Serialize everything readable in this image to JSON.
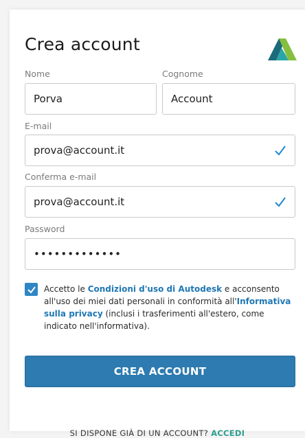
{
  "form": {
    "title": "Crea account",
    "first_name_label": "Nome",
    "first_name_value": "Porva",
    "last_name_label": "Cognome",
    "last_name_value": "Account",
    "email_label": "E-mail",
    "email_value": "prova@account.it",
    "confirm_email_label": "Conferma e-mail",
    "confirm_email_value": "prova@account.it",
    "password_label": "Password",
    "password_value": "•••••••••••••"
  },
  "consent": {
    "checked": true,
    "text_1": "Accetto le ",
    "terms_link": "Condizioni d'uso di Autodesk",
    "text_2": " e acconsento all'uso dei miei dati personali in conformità all'",
    "privacy_link": "Informativa sulla privacy",
    "text_3": " (inclusi i trasferimenti all'estero, come indicato nell'informativa)."
  },
  "submit_label": "CREA ACCOUNT",
  "footer": {
    "prompt": "SI DISPONE GIÀ DI UN ACCOUNT? ",
    "signin_link": "ACCEDI"
  },
  "colors": {
    "accent": "#2d7bb0",
    "link": "#1f77b4",
    "check": "#1f87d0",
    "signin": "#2e9e8f"
  },
  "icons": {
    "logo": "autodesk-logo",
    "valid": "checkmark-icon",
    "checkbox": "checkbox-checked-icon"
  }
}
